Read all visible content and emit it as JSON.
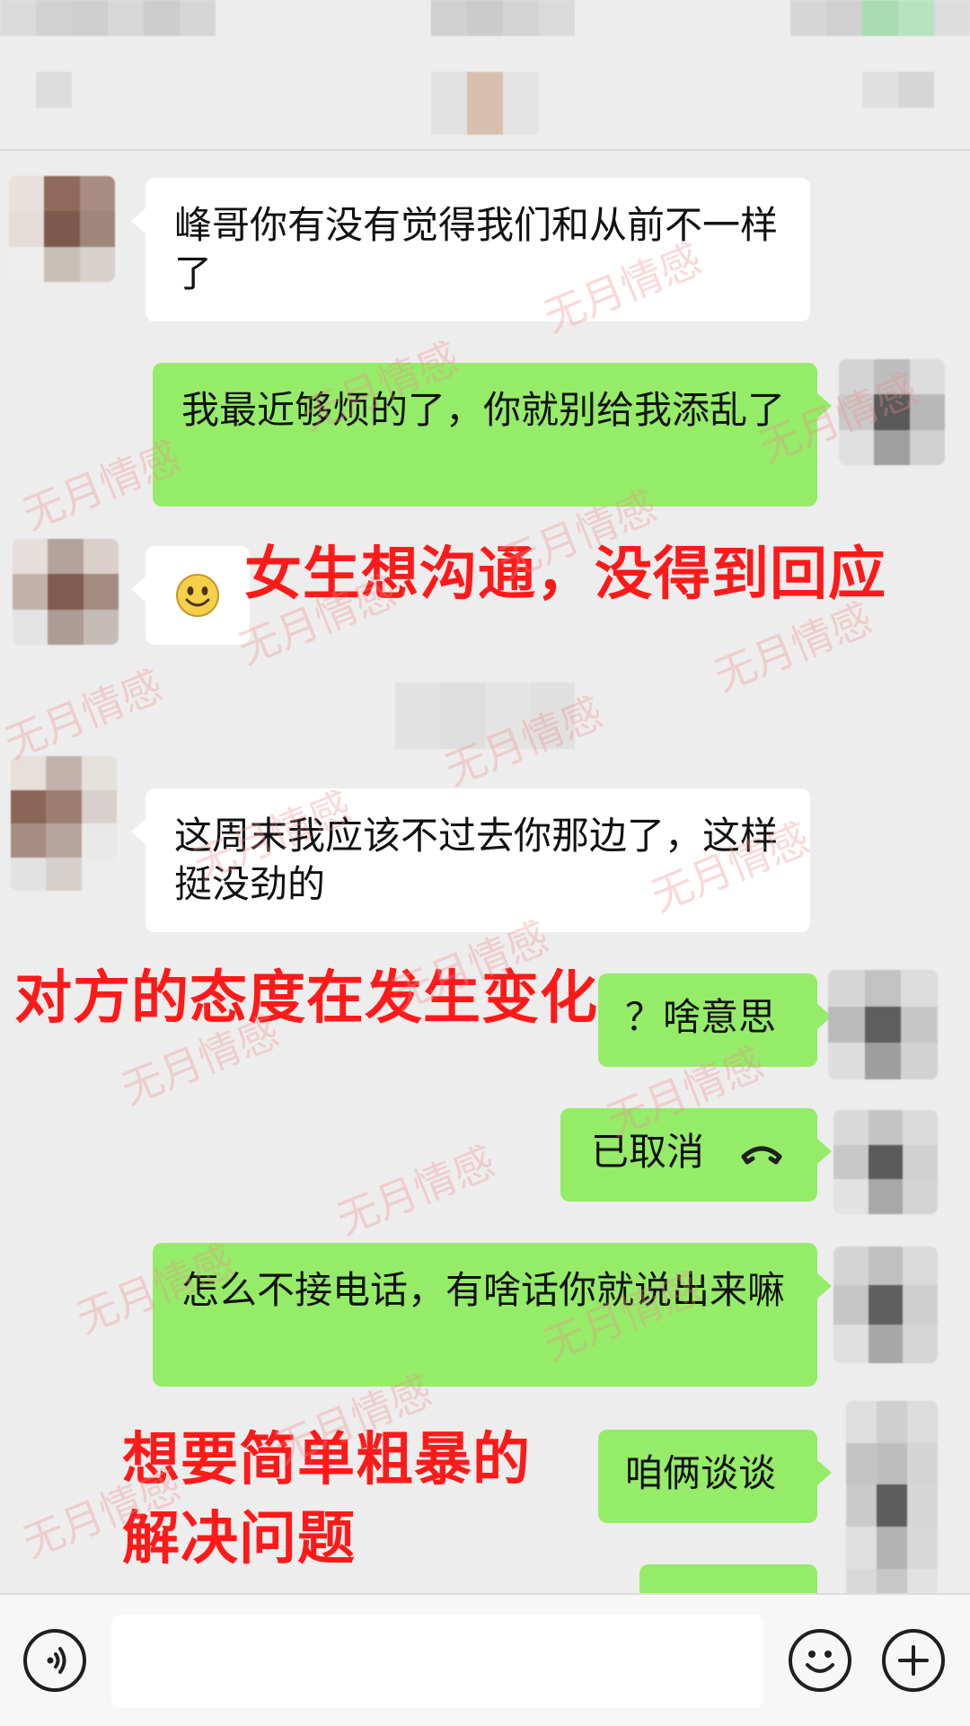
{
  "messages": [
    {
      "side": "in",
      "text": "峰哥你有没有觉得我们和从前不一样了"
    },
    {
      "side": "out",
      "text": "我最近够烦的了，你就别给我添乱了"
    },
    {
      "side": "in",
      "type": "emoji",
      "emoji": "smiley"
    },
    {
      "side": "in",
      "text": "这周末我应该不过去你那边了，这样挺没劲的"
    },
    {
      "side": "out",
      "text": "？啥意思"
    },
    {
      "side": "out",
      "type": "call",
      "text": "已取消",
      "icon": "phone-hangup-icon"
    },
    {
      "side": "out",
      "text": "怎么不接电话，有啥话你就说出来嘛"
    },
    {
      "side": "out",
      "text": "咱俩谈谈"
    }
  ],
  "annotations": {
    "no_response": "女生想沟通，没得到回应",
    "attitude_change": "对方的态度在发生变化",
    "simple_solution_line1": "想要简单粗暴的",
    "simple_solution_line2": "解决问题"
  },
  "watermark": "无月情感",
  "input_bar": {
    "left_icon": "voice-icon",
    "right_icons": [
      "emoji-icon",
      "plus-icon"
    ]
  },
  "colors": {
    "background": "#ededed",
    "bubble_out": "#95ec69",
    "bubble_in": "#ffffff",
    "annotation": "#ff1a1a"
  }
}
